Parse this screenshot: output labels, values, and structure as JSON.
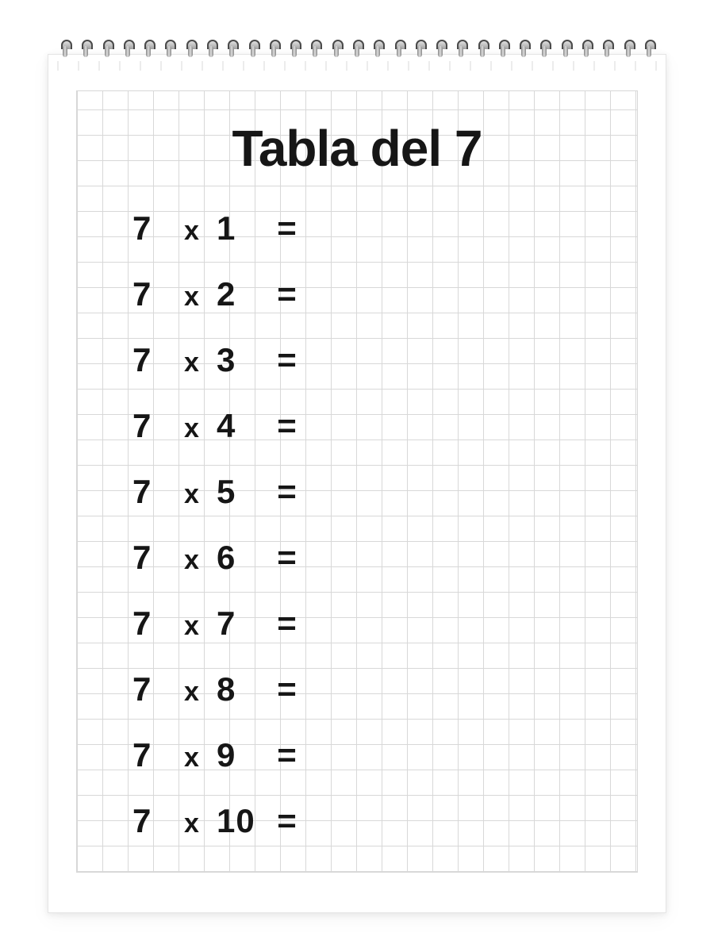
{
  "title": "Tabla del 7",
  "operator": "x",
  "equals": "=",
  "rows": [
    {
      "a": "7",
      "b": "1",
      "answer": ""
    },
    {
      "a": "7",
      "b": "2",
      "answer": ""
    },
    {
      "a": "7",
      "b": "3",
      "answer": ""
    },
    {
      "a": "7",
      "b": "4",
      "answer": ""
    },
    {
      "a": "7",
      "b": "5",
      "answer": ""
    },
    {
      "a": "7",
      "b": "6",
      "answer": ""
    },
    {
      "a": "7",
      "b": "7",
      "answer": ""
    },
    {
      "a": "7",
      "b": "8",
      "answer": ""
    },
    {
      "a": "7",
      "b": "9",
      "answer": ""
    },
    {
      "a": "7",
      "b": "10",
      "answer": ""
    }
  ]
}
